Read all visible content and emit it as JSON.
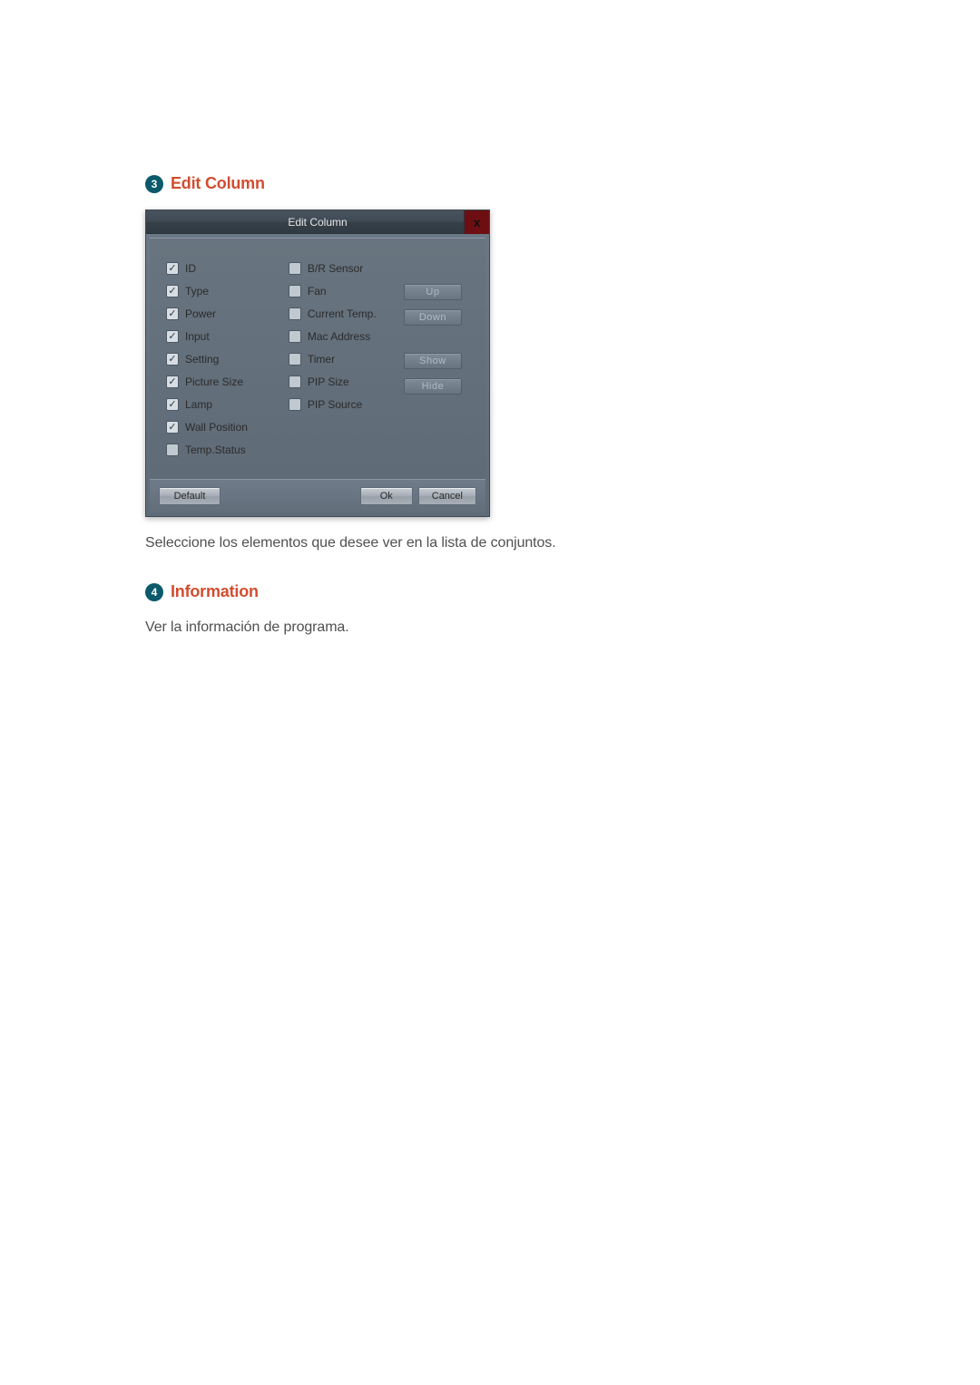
{
  "sections": {
    "editColumn": {
      "badge": "3",
      "title": "Edit Column",
      "caption": "Seleccione los elementos que desee ver en la lista de conjuntos."
    },
    "information": {
      "badge": "4",
      "title": "Information",
      "text": "Ver la información de programa."
    }
  },
  "dialog": {
    "title": "Edit Column",
    "closeGlyph": "x",
    "leftColumn": [
      {
        "label": "ID",
        "checked": true
      },
      {
        "label": "Type",
        "checked": true
      },
      {
        "label": "Power",
        "checked": true
      },
      {
        "label": "Input",
        "checked": true
      },
      {
        "label": "Setting",
        "checked": true
      },
      {
        "label": "Picture Size",
        "checked": true
      },
      {
        "label": "Lamp",
        "checked": true
      },
      {
        "label": "Wall Position",
        "checked": true
      },
      {
        "label": "Temp.Status",
        "checked": false
      }
    ],
    "midColumn": [
      {
        "label": "B/R Sensor",
        "checked": false
      },
      {
        "label": "Fan",
        "checked": false
      },
      {
        "label": "Current Temp.",
        "checked": false
      },
      {
        "label": "Mac Address",
        "checked": false
      },
      {
        "label": "Timer",
        "checked": false
      },
      {
        "label": "PIP Size",
        "checked": false
      },
      {
        "label": "PIP Source",
        "checked": false
      }
    ],
    "sideButtons": {
      "up": "Up",
      "down": "Down",
      "show": "Show",
      "hide": "Hide"
    },
    "footer": {
      "default": "Default",
      "ok": "Ok",
      "cancel": "Cancel"
    }
  }
}
